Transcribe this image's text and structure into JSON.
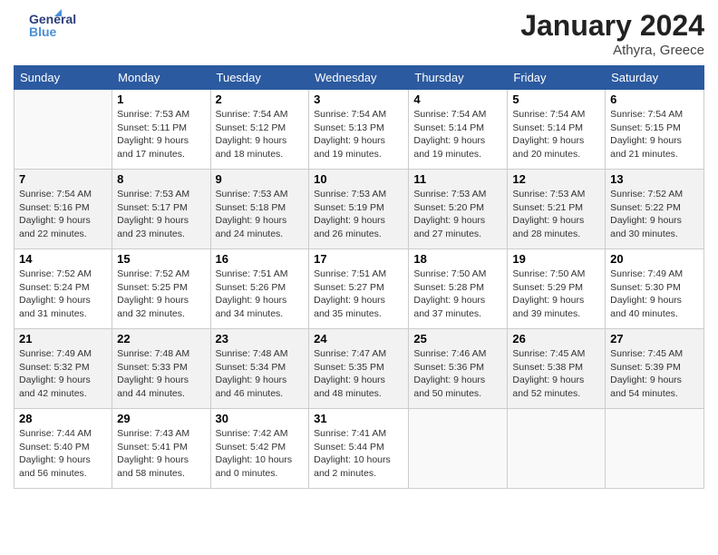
{
  "header": {
    "logo_line1": "General",
    "logo_line2": "Blue",
    "month_title": "January 2024",
    "location": "Athyra, Greece"
  },
  "weekdays": [
    "Sunday",
    "Monday",
    "Tuesday",
    "Wednesday",
    "Thursday",
    "Friday",
    "Saturday"
  ],
  "weeks": [
    [
      {
        "day": "",
        "sunrise": "",
        "sunset": "",
        "daylight": ""
      },
      {
        "day": "1",
        "sunrise": "Sunrise: 7:53 AM",
        "sunset": "Sunset: 5:11 PM",
        "daylight": "Daylight: 9 hours and 17 minutes."
      },
      {
        "day": "2",
        "sunrise": "Sunrise: 7:54 AM",
        "sunset": "Sunset: 5:12 PM",
        "daylight": "Daylight: 9 hours and 18 minutes."
      },
      {
        "day": "3",
        "sunrise": "Sunrise: 7:54 AM",
        "sunset": "Sunset: 5:13 PM",
        "daylight": "Daylight: 9 hours and 19 minutes."
      },
      {
        "day": "4",
        "sunrise": "Sunrise: 7:54 AM",
        "sunset": "Sunset: 5:14 PM",
        "daylight": "Daylight: 9 hours and 19 minutes."
      },
      {
        "day": "5",
        "sunrise": "Sunrise: 7:54 AM",
        "sunset": "Sunset: 5:14 PM",
        "daylight": "Daylight: 9 hours and 20 minutes."
      },
      {
        "day": "6",
        "sunrise": "Sunrise: 7:54 AM",
        "sunset": "Sunset: 5:15 PM",
        "daylight": "Daylight: 9 hours and 21 minutes."
      }
    ],
    [
      {
        "day": "7",
        "sunrise": "Sunrise: 7:54 AM",
        "sunset": "Sunset: 5:16 PM",
        "daylight": "Daylight: 9 hours and 22 minutes."
      },
      {
        "day": "8",
        "sunrise": "Sunrise: 7:53 AM",
        "sunset": "Sunset: 5:17 PM",
        "daylight": "Daylight: 9 hours and 23 minutes."
      },
      {
        "day": "9",
        "sunrise": "Sunrise: 7:53 AM",
        "sunset": "Sunset: 5:18 PM",
        "daylight": "Daylight: 9 hours and 24 minutes."
      },
      {
        "day": "10",
        "sunrise": "Sunrise: 7:53 AM",
        "sunset": "Sunset: 5:19 PM",
        "daylight": "Daylight: 9 hours and 26 minutes."
      },
      {
        "day": "11",
        "sunrise": "Sunrise: 7:53 AM",
        "sunset": "Sunset: 5:20 PM",
        "daylight": "Daylight: 9 hours and 27 minutes."
      },
      {
        "day": "12",
        "sunrise": "Sunrise: 7:53 AM",
        "sunset": "Sunset: 5:21 PM",
        "daylight": "Daylight: 9 hours and 28 minutes."
      },
      {
        "day": "13",
        "sunrise": "Sunrise: 7:52 AM",
        "sunset": "Sunset: 5:22 PM",
        "daylight": "Daylight: 9 hours and 30 minutes."
      }
    ],
    [
      {
        "day": "14",
        "sunrise": "Sunrise: 7:52 AM",
        "sunset": "Sunset: 5:24 PM",
        "daylight": "Daylight: 9 hours and 31 minutes."
      },
      {
        "day": "15",
        "sunrise": "Sunrise: 7:52 AM",
        "sunset": "Sunset: 5:25 PM",
        "daylight": "Daylight: 9 hours and 32 minutes."
      },
      {
        "day": "16",
        "sunrise": "Sunrise: 7:51 AM",
        "sunset": "Sunset: 5:26 PM",
        "daylight": "Daylight: 9 hours and 34 minutes."
      },
      {
        "day": "17",
        "sunrise": "Sunrise: 7:51 AM",
        "sunset": "Sunset: 5:27 PM",
        "daylight": "Daylight: 9 hours and 35 minutes."
      },
      {
        "day": "18",
        "sunrise": "Sunrise: 7:50 AM",
        "sunset": "Sunset: 5:28 PM",
        "daylight": "Daylight: 9 hours and 37 minutes."
      },
      {
        "day": "19",
        "sunrise": "Sunrise: 7:50 AM",
        "sunset": "Sunset: 5:29 PM",
        "daylight": "Daylight: 9 hours and 39 minutes."
      },
      {
        "day": "20",
        "sunrise": "Sunrise: 7:49 AM",
        "sunset": "Sunset: 5:30 PM",
        "daylight": "Daylight: 9 hours and 40 minutes."
      }
    ],
    [
      {
        "day": "21",
        "sunrise": "Sunrise: 7:49 AM",
        "sunset": "Sunset: 5:32 PM",
        "daylight": "Daylight: 9 hours and 42 minutes."
      },
      {
        "day": "22",
        "sunrise": "Sunrise: 7:48 AM",
        "sunset": "Sunset: 5:33 PM",
        "daylight": "Daylight: 9 hours and 44 minutes."
      },
      {
        "day": "23",
        "sunrise": "Sunrise: 7:48 AM",
        "sunset": "Sunset: 5:34 PM",
        "daylight": "Daylight: 9 hours and 46 minutes."
      },
      {
        "day": "24",
        "sunrise": "Sunrise: 7:47 AM",
        "sunset": "Sunset: 5:35 PM",
        "daylight": "Daylight: 9 hours and 48 minutes."
      },
      {
        "day": "25",
        "sunrise": "Sunrise: 7:46 AM",
        "sunset": "Sunset: 5:36 PM",
        "daylight": "Daylight: 9 hours and 50 minutes."
      },
      {
        "day": "26",
        "sunrise": "Sunrise: 7:45 AM",
        "sunset": "Sunset: 5:38 PM",
        "daylight": "Daylight: 9 hours and 52 minutes."
      },
      {
        "day": "27",
        "sunrise": "Sunrise: 7:45 AM",
        "sunset": "Sunset: 5:39 PM",
        "daylight": "Daylight: 9 hours and 54 minutes."
      }
    ],
    [
      {
        "day": "28",
        "sunrise": "Sunrise: 7:44 AM",
        "sunset": "Sunset: 5:40 PM",
        "daylight": "Daylight: 9 hours and 56 minutes."
      },
      {
        "day": "29",
        "sunrise": "Sunrise: 7:43 AM",
        "sunset": "Sunset: 5:41 PM",
        "daylight": "Daylight: 9 hours and 58 minutes."
      },
      {
        "day": "30",
        "sunrise": "Sunrise: 7:42 AM",
        "sunset": "Sunset: 5:42 PM",
        "daylight": "Daylight: 10 hours and 0 minutes."
      },
      {
        "day": "31",
        "sunrise": "Sunrise: 7:41 AM",
        "sunset": "Sunset: 5:44 PM",
        "daylight": "Daylight: 10 hours and 2 minutes."
      },
      {
        "day": "",
        "sunrise": "",
        "sunset": "",
        "daylight": ""
      },
      {
        "day": "",
        "sunrise": "",
        "sunset": "",
        "daylight": ""
      },
      {
        "day": "",
        "sunrise": "",
        "sunset": "",
        "daylight": ""
      }
    ]
  ]
}
